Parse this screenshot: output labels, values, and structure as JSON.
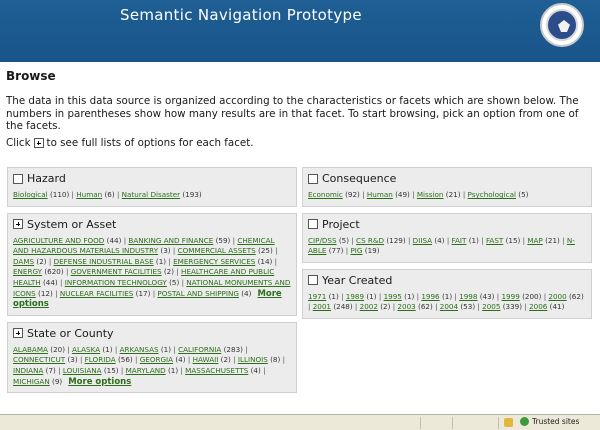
{
  "header": {
    "title": "Semantic Navigation Prototype"
  },
  "page": {
    "heading": "Browse",
    "intro": "The data in this data source is organized according to the characteristics or facets which are shown below. The numbers in parentheses show how many results are in that facet. To start browsing, pick an option from one of the facets.",
    "click_before": "Click",
    "click_after": "to see full lists of options for each facet."
  },
  "panels": {
    "hazard": {
      "title": "Hazard",
      "items": [
        {
          "label": "Biological",
          "count": "(110)"
        },
        {
          "label": "Human",
          "count": "(6)"
        },
        {
          "label": "Natural Disaster",
          "count": "(193)"
        }
      ]
    },
    "consequence": {
      "title": "Consequence",
      "items": [
        {
          "label": "Economic",
          "count": "(92)"
        },
        {
          "label": "Human",
          "count": "(49)"
        },
        {
          "label": "Mission",
          "count": "(21)"
        },
        {
          "label": "Psychological",
          "count": "(5)"
        }
      ]
    },
    "system": {
      "title": "System or Asset",
      "more": "More options",
      "items": [
        {
          "label": "AGRICULTURE AND FOOD",
          "count": "(44)"
        },
        {
          "label": "BANKING AND FINANCE",
          "count": "(59)"
        },
        {
          "label": "CHEMICAL AND HAZARDOUS MATERIALS INDUSTRY",
          "count": "(3)"
        },
        {
          "label": "COMMERCIAL ASSETS",
          "count": "(25)"
        },
        {
          "label": "DAMS",
          "count": "(2)"
        },
        {
          "label": "DEFENSE INDUSTRIAL BASE",
          "count": "(1)"
        },
        {
          "label": "EMERGENCY SERVICES",
          "count": "(14)"
        },
        {
          "label": "ENERGY",
          "count": "(620)"
        },
        {
          "label": "GOVERNMENT FACILITIES",
          "count": "(2)"
        },
        {
          "label": "HEALTHCARE AND PUBLIC HEALTH",
          "count": "(44)"
        },
        {
          "label": "INFORMATION TECHNOLOGY",
          "count": "(5)"
        },
        {
          "label": "NATIONAL MONUMENTS AND ICONS",
          "count": "(12)"
        },
        {
          "label": "NUCLEAR FACILITIES",
          "count": "(17)"
        },
        {
          "label": "POSTAL AND SHIPPING",
          "count": "(4)"
        }
      ]
    },
    "project": {
      "title": "Project",
      "items": [
        {
          "label": "CIP/DSS",
          "count": "(5)"
        },
        {
          "label": "CS R&D",
          "count": "(129)"
        },
        {
          "label": "DIISA",
          "count": "(4)"
        },
        {
          "label": "FAIT",
          "count": "(1)"
        },
        {
          "label": "FAST",
          "count": "(15)"
        },
        {
          "label": "MAP",
          "count": "(21)"
        },
        {
          "label": "N-ABLE",
          "count": "(77)"
        },
        {
          "label": "PIG",
          "count": "(19)"
        }
      ]
    },
    "year": {
      "title": "Year Created",
      "items": [
        {
          "label": "1971",
          "count": "(1)"
        },
        {
          "label": "1989",
          "count": "(1)"
        },
        {
          "label": "1995",
          "count": "(1)"
        },
        {
          "label": "1996",
          "count": "(1)"
        },
        {
          "label": "1998",
          "count": "(43)"
        },
        {
          "label": "1999",
          "count": "(200)"
        },
        {
          "label": "2000",
          "count": "(62)"
        },
        {
          "label": "2001",
          "count": "(248)"
        },
        {
          "label": "2002",
          "count": "(2)"
        },
        {
          "label": "2003",
          "count": "(62)"
        },
        {
          "label": "2004",
          "count": "(53)"
        },
        {
          "label": "2005",
          "count": "(339)"
        },
        {
          "label": "2006",
          "count": "(41)"
        }
      ]
    },
    "state": {
      "title": "State or County",
      "more": "More options",
      "items": [
        {
          "label": "ALABAMA",
          "count": "(20)"
        },
        {
          "label": "ALASKA",
          "count": "(1)"
        },
        {
          "label": "ARKANSAS",
          "count": "(1)"
        },
        {
          "label": "CALIFORNIA",
          "count": "(283)"
        },
        {
          "label": "CONNECTICUT",
          "count": "(3)"
        },
        {
          "label": "FLORIDA",
          "count": "(56)"
        },
        {
          "label": "GEORGIA",
          "count": "(4)"
        },
        {
          "label": "HAWAII",
          "count": "(2)"
        },
        {
          "label": "ILLINOIS",
          "count": "(8)"
        },
        {
          "label": "INDIANA",
          "count": "(7)"
        },
        {
          "label": "LOUISIANA",
          "count": "(15)"
        },
        {
          "label": "MARYLAND",
          "count": "(1)"
        },
        {
          "label": "MASSACHUSETTS",
          "count": "(4)"
        },
        {
          "label": "MICHIGAN",
          "count": "(9)"
        }
      ]
    }
  },
  "statusbar": {
    "zone": "Trusted sites"
  },
  "icons": {
    "seal": "dhs-seal-icon",
    "plus": "plus-expand-icon",
    "checkbox": "checkbox-icon",
    "lock": "lock-icon",
    "zone": "trusted-zone-icon"
  },
  "colors": {
    "header": "#1f5f94",
    "link": "#2d6e1b",
    "panel": "#ececec"
  }
}
